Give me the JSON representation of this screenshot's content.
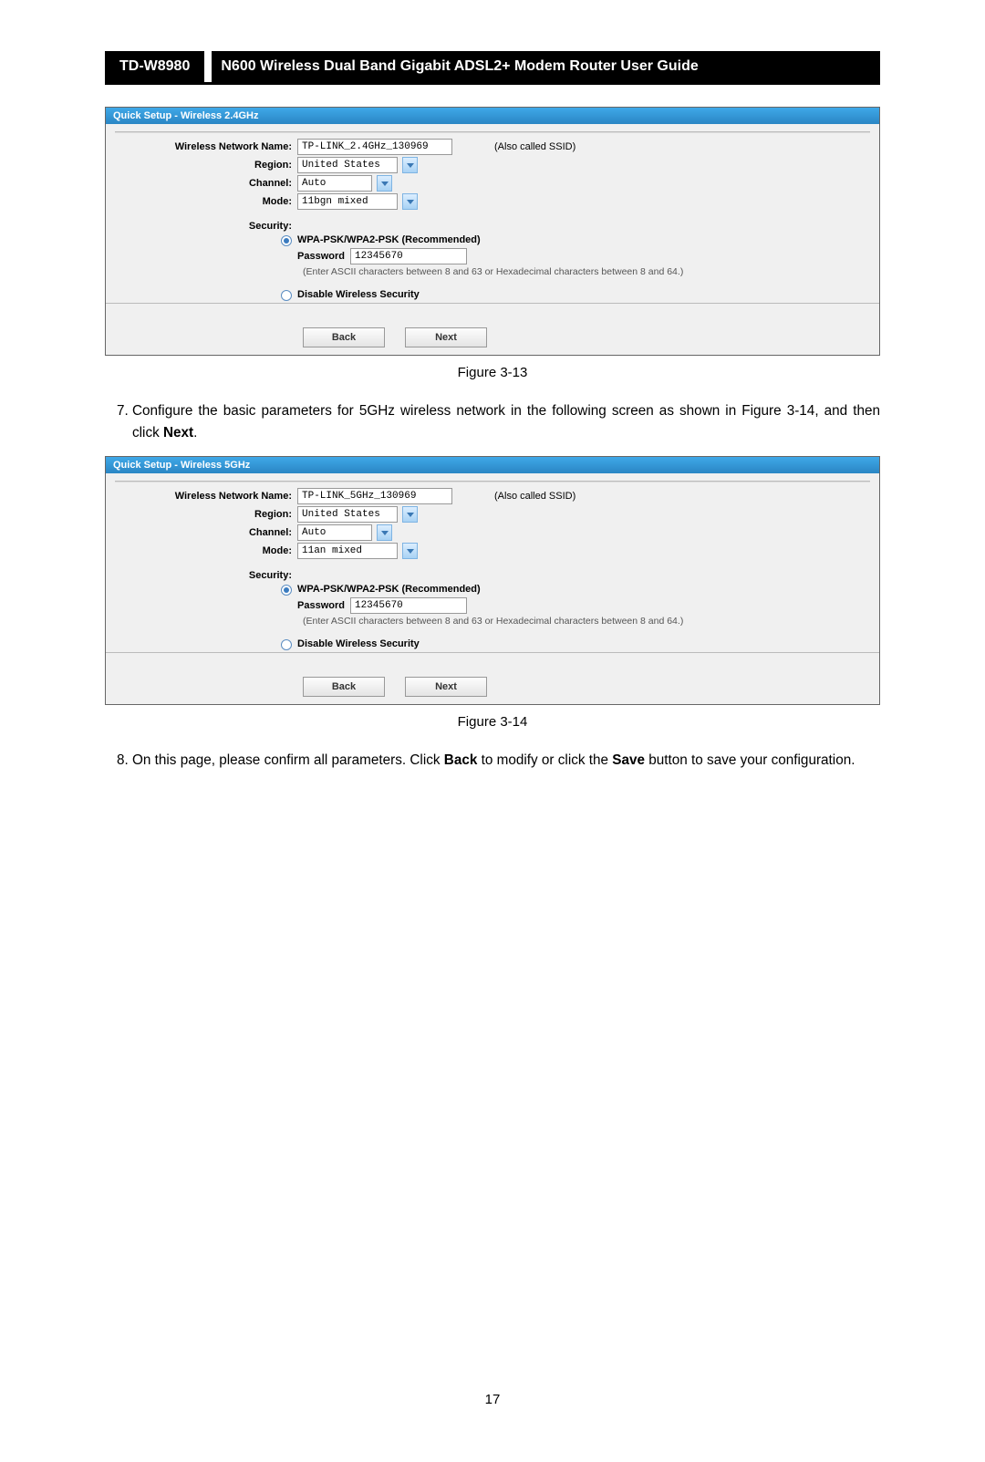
{
  "header": {
    "model": "TD-W8980",
    "title": "N600 Wireless Dual Band Gigabit ADSL2+ Modem Router User Guide"
  },
  "panel24": {
    "title": "Quick Setup - Wireless 2.4GHz",
    "labels": {
      "wnn": "Wireless Network Name:",
      "region": "Region:",
      "channel": "Channel:",
      "mode": "Mode:",
      "security": "Security:",
      "password": "Password"
    },
    "values": {
      "wnn": "TP-LINK_2.4GHz_130969",
      "ssid_note": "(Also called SSID)",
      "region": "United States",
      "channel": "Auto",
      "mode": "11bgn mixed",
      "wpa_label": "WPA-PSK/WPA2-PSK (Recommended)",
      "password": "12345670",
      "pw_hint": "(Enter ASCII characters between 8 and 63 or Hexadecimal characters between 8 and 64.)",
      "disable": "Disable Wireless Security"
    },
    "buttons": {
      "back": "Back",
      "next": "Next"
    }
  },
  "captions": {
    "fig313": "Figure 3-13",
    "fig314": "Figure 3-14"
  },
  "step7": {
    "num": "7.",
    "text_a": "Configure the basic parameters for 5GHz wireless network in the following screen as shown in Figure 3-14, and then click ",
    "text_b": "Next",
    "text_c": "."
  },
  "panel5": {
    "title": "Quick Setup - Wireless 5GHz",
    "labels": {
      "wnn": "Wireless Network Name:",
      "region": "Region:",
      "channel": "Channel:",
      "mode": "Mode:",
      "security": "Security:",
      "password": "Password"
    },
    "values": {
      "wnn": "TP-LINK_5GHz_130969",
      "ssid_note": "(Also called SSID)",
      "region": "United States",
      "channel": "Auto",
      "mode": "11an mixed",
      "wpa_label": "WPA-PSK/WPA2-PSK (Recommended)",
      "password": "12345670",
      "pw_hint": "(Enter ASCII characters between 8 and 63 or Hexadecimal characters between 8 and 64.)",
      "disable": "Disable Wireless Security"
    },
    "buttons": {
      "back": "Back",
      "next": "Next"
    }
  },
  "step8": {
    "num": "8.",
    "text_a": "On this page, please confirm all parameters. Click ",
    "text_b": "Back",
    "text_c": " to modify or click the ",
    "text_d": "Save",
    "text_e": " button to save your configuration."
  },
  "pagenum": "17"
}
